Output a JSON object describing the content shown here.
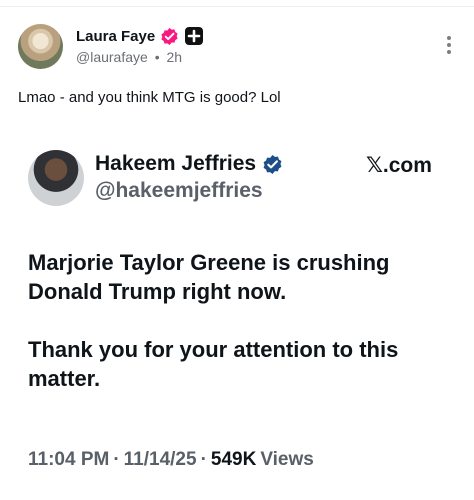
{
  "post": {
    "author_name": "Laura Faye",
    "handle": "@laurafaye",
    "separator": "•",
    "time": "2h",
    "text": "Lmao - and you think MTG is good? Lol",
    "verified_color": "#f91880",
    "badge_icon": "plus-badge-icon",
    "menu_icon": "more-vertical-icon"
  },
  "embed": {
    "author_name": "Hakeem Jeffries",
    "handle": "@hakeemjeffries",
    "source_label": ".com",
    "source_glyph": "𝕏",
    "verified_color": "#1d9bf0",
    "paragraphs": [
      "Marjorie Taylor Greene is crushing Donald Trump right now.",
      "Thank you for your attention to this matter."
    ],
    "time": "11:04 PM",
    "dot": "·",
    "date": "11/14/25",
    "views_count": "549K",
    "views_label": "Views"
  }
}
